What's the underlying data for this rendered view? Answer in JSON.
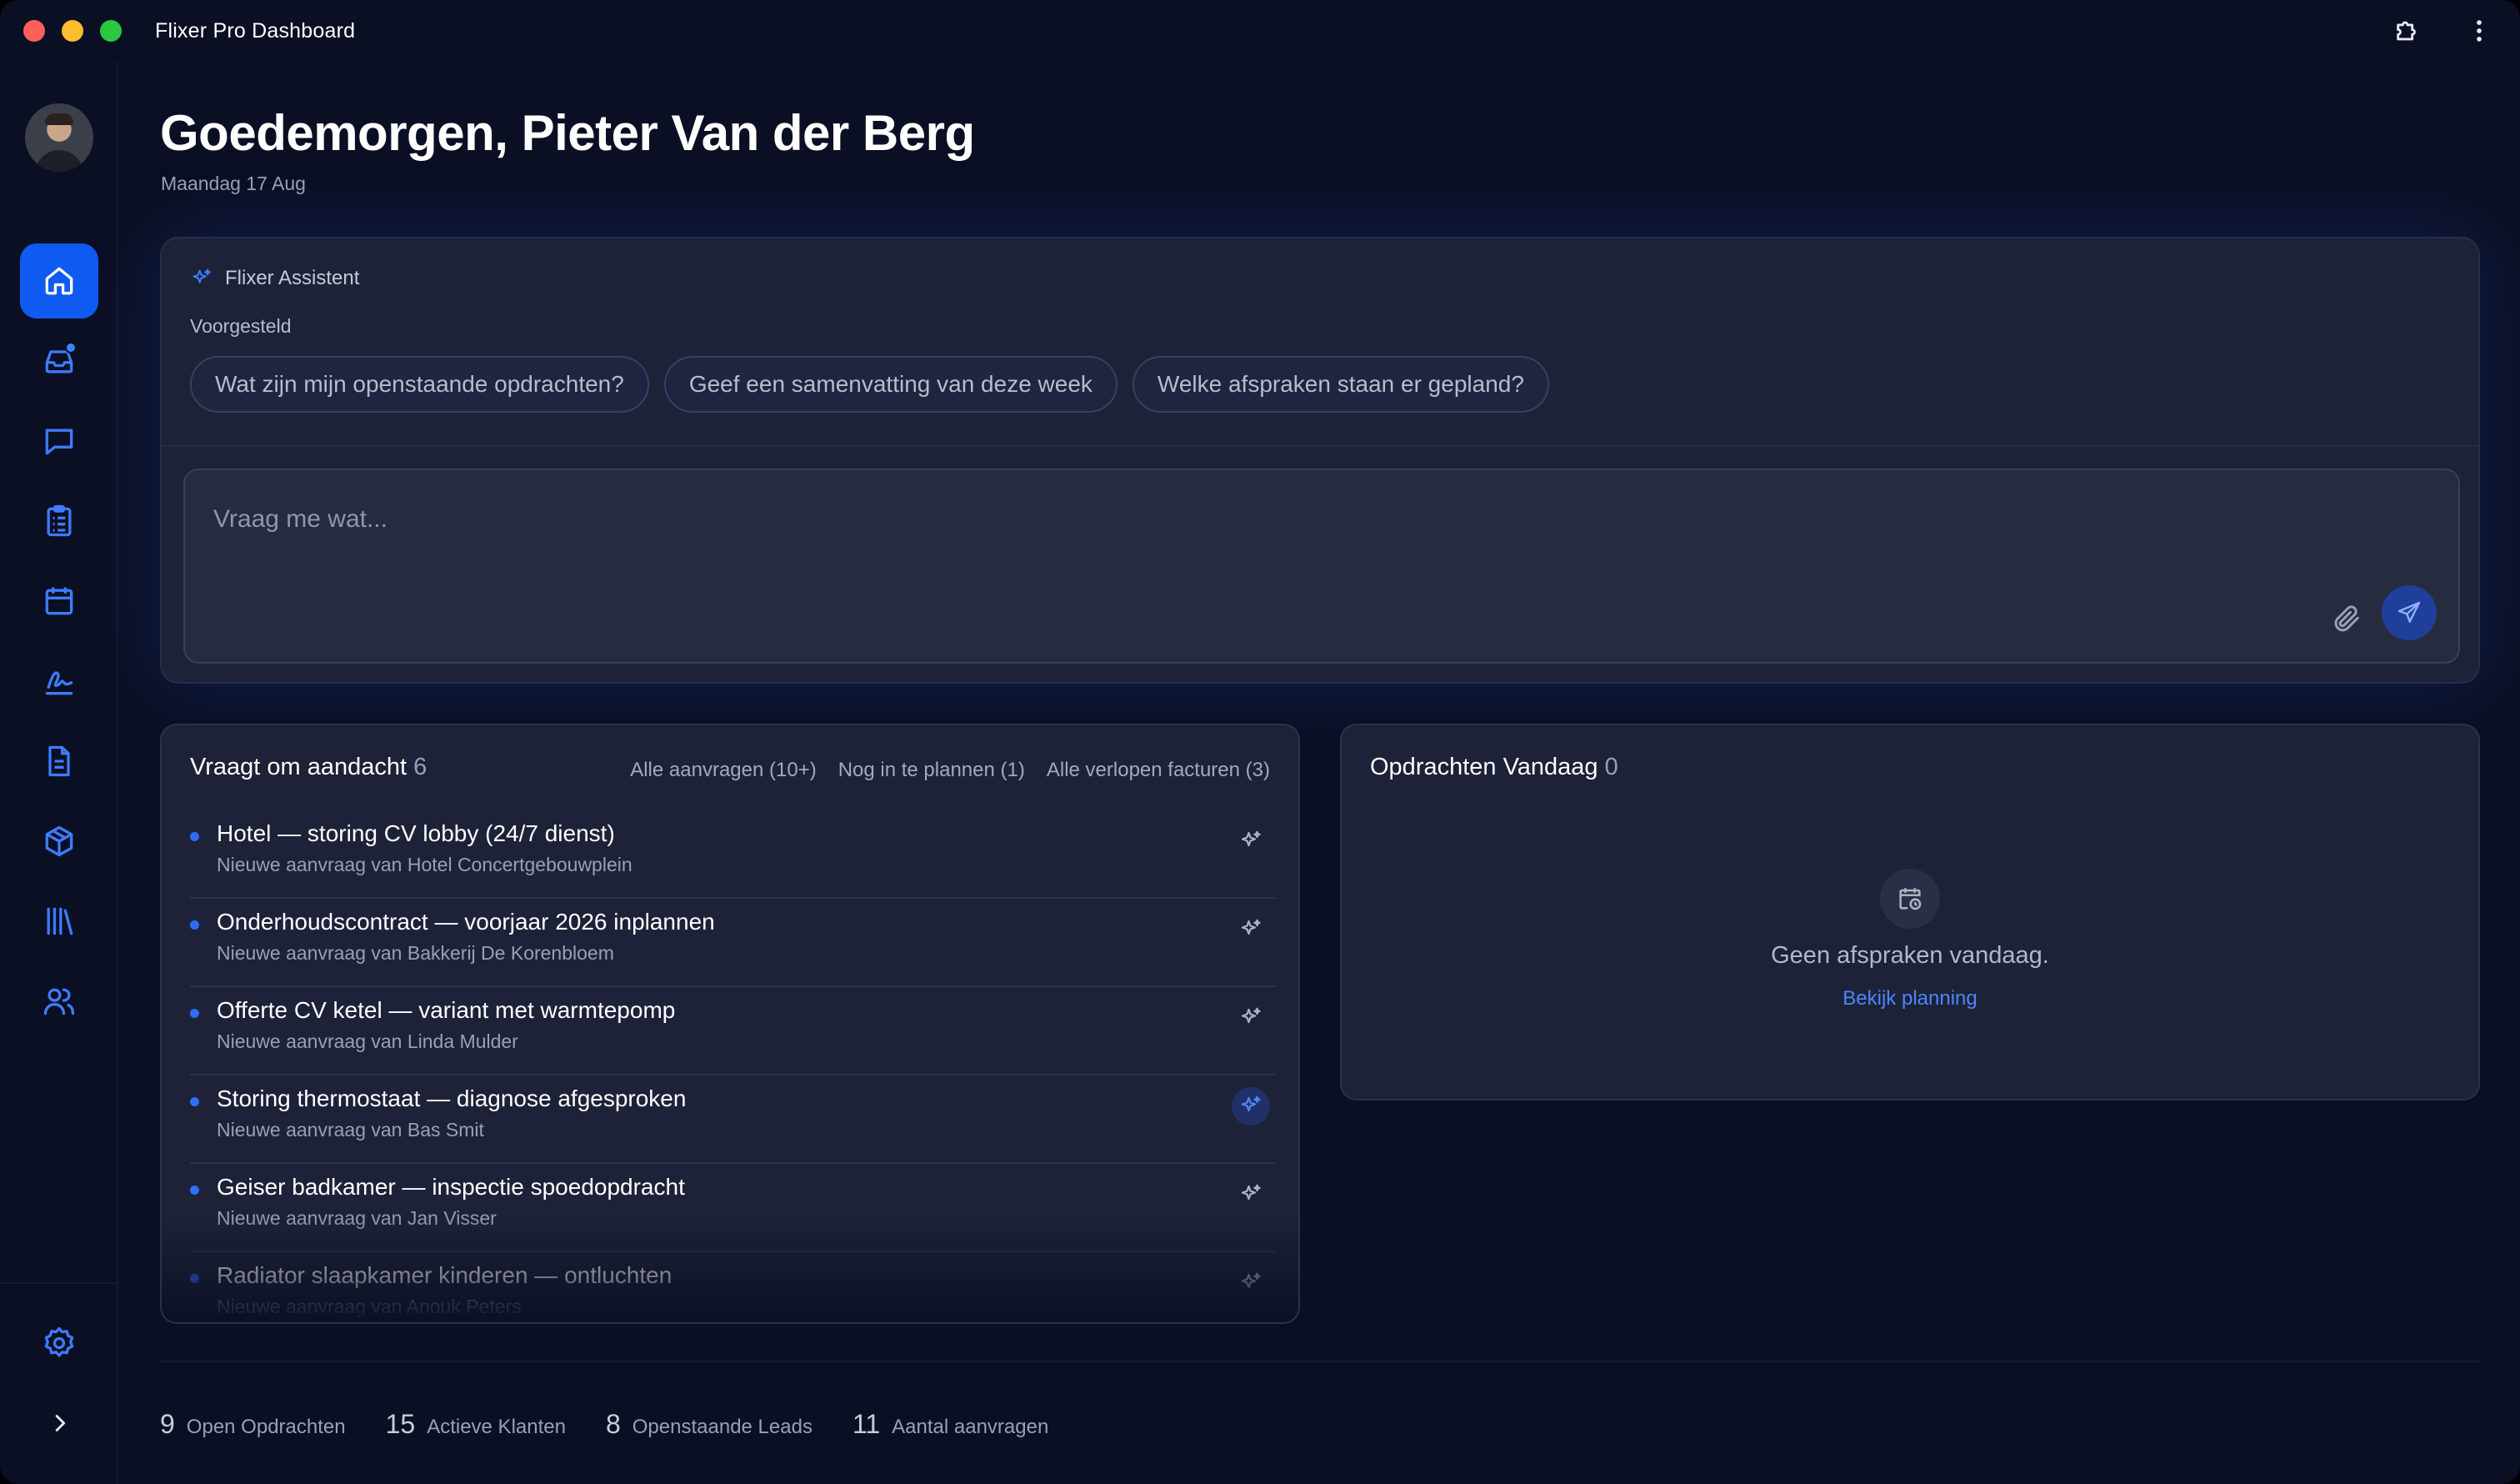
{
  "window": {
    "title": "Flixer Pro Dashboard"
  },
  "header": {
    "greeting": "Goedemorgen, Pieter Van der Berg",
    "date": "Maandag 17 Aug"
  },
  "sidebar": {
    "items": [
      {
        "name": "home",
        "icon": "home-icon",
        "active": true
      },
      {
        "name": "inbox",
        "icon": "inbox-icon",
        "badge": true
      },
      {
        "name": "messages",
        "icon": "chat-icon"
      },
      {
        "name": "tasks",
        "icon": "clipboard-list-icon"
      },
      {
        "name": "calendar",
        "icon": "calendar-icon"
      },
      {
        "name": "signature",
        "icon": "signature-icon"
      },
      {
        "name": "documents",
        "icon": "document-icon"
      },
      {
        "name": "products",
        "icon": "package-icon"
      },
      {
        "name": "library",
        "icon": "library-icon"
      },
      {
        "name": "customers",
        "icon": "users-icon"
      }
    ],
    "settings_icon": "gear-icon",
    "expand_icon": "chevron-right-icon"
  },
  "assistant": {
    "title": "Flixer Assistent",
    "suggested_label": "Voorgesteld",
    "chips": [
      "Wat zijn mijn openstaande opdrachten?",
      "Geef een samenvatting van deze week",
      "Welke afspraken staan er gepland?"
    ],
    "input_placeholder": "Vraag me wat..."
  },
  "attention": {
    "title": "Vraagt om aandacht",
    "count": "6",
    "filters": [
      "Alle aanvragen (10+)",
      "Nog in te plannen (1)",
      "Alle verlopen facturen (3)"
    ],
    "items": [
      {
        "title": "Hotel — storing CV lobby (24/7 dienst)",
        "subtitle": "Nieuwe aanvraag van Hotel Concertgebouwplein"
      },
      {
        "title": "Onderhoudscontract — voorjaar 2026 inplannen",
        "subtitle": "Nieuwe aanvraag van Bakkerij De Korenbloem"
      },
      {
        "title": "Offerte CV ketel — variant met warmtepomp",
        "subtitle": "Nieuwe aanvraag van Linda Mulder"
      },
      {
        "title": "Storing thermostaat — diagnose afgesproken",
        "subtitle": "Nieuwe aanvraag van Bas Smit"
      },
      {
        "title": "Geiser badkamer — inspectie spoedopdracht",
        "subtitle": "Nieuwe aanvraag van Jan Visser"
      },
      {
        "title": "Radiator slaapkamer kinderen — ontluchten",
        "subtitle": "Nieuwe aanvraag van Anouk Peters"
      }
    ]
  },
  "today": {
    "title": "Opdrachten Vandaag",
    "count": "0",
    "empty_text": "Geen afspraken vandaag.",
    "link": "Bekijk planning"
  },
  "stats": [
    {
      "value": "9",
      "label": "Open Opdrachten"
    },
    {
      "value": "15",
      "label": "Actieve Klanten"
    },
    {
      "value": "8",
      "label": "Openstaande Leads"
    },
    {
      "value": "11",
      "label": "Aantal aanvragen"
    }
  ],
  "colors": {
    "accent": "#0f5bf2",
    "link": "#4b86ff",
    "background": "#0b0f24",
    "card": "#1d2238"
  }
}
